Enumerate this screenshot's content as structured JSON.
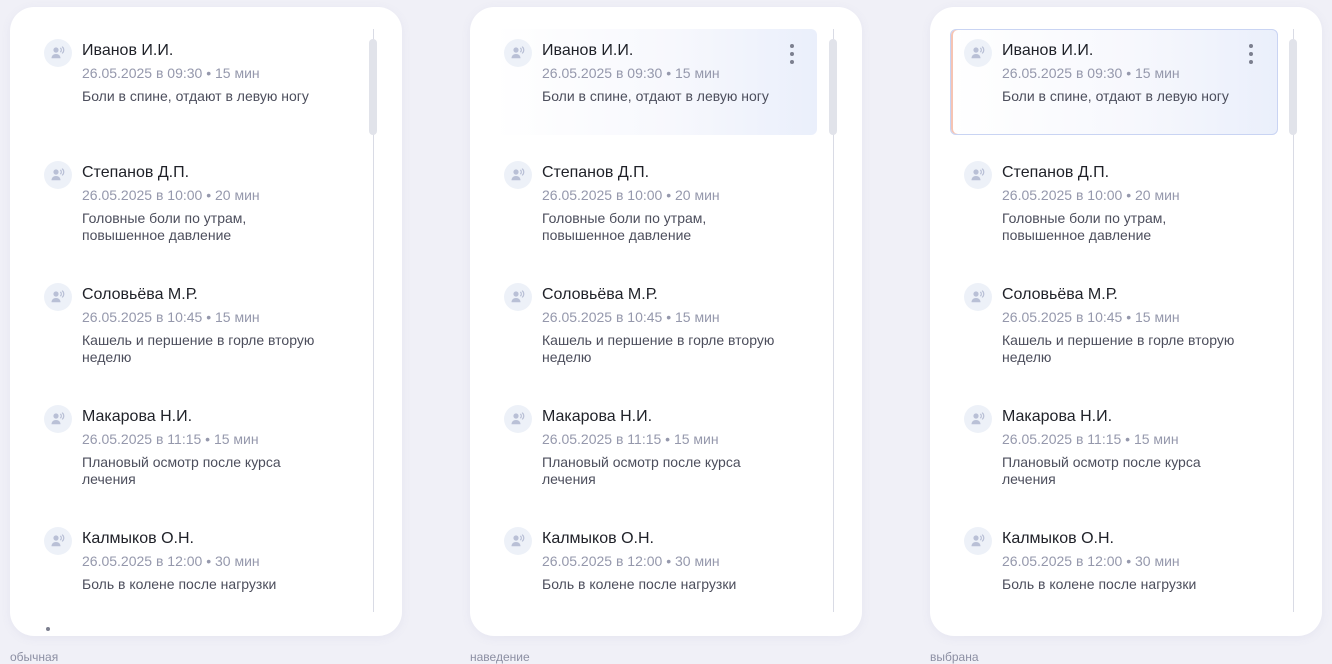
{
  "captions": [
    "обычная",
    "наведение",
    "выбрана"
  ],
  "appointments": [
    {
      "patient": "Иванов И.И.",
      "datetime": "26.05.2025 в 09:30 • 15 мин",
      "complaint": "Боли в спине, отдают в левую ногу"
    },
    {
      "patient": "Степанов Д.П.",
      "datetime": "26.05.2025 в 10:00 • 20 мин",
      "complaint": "Головные боли по утрам, повышенное давление"
    },
    {
      "patient": "Соловьёва М.Р.",
      "datetime": "26.05.2025 в 10:45 • 15 мин",
      "complaint": "Кашель и першение в горле вторую неделю"
    },
    {
      "patient": "Макарова Н.И.",
      "datetime": "26.05.2025 в 11:15 • 15 мин",
      "complaint": "Плановый осмотр после курса лечения"
    },
    {
      "patient": "Калмыков О.Н.",
      "datetime": "26.05.2025 в 12:00 • 30 мин",
      "complaint": "Боль в колене после нагрузки"
    }
  ],
  "icons": {
    "avatar": "user-voice-icon",
    "more": "more-vertical-icon"
  },
  "colors": {
    "page_bg": "#f0f0f7",
    "panel_bg": "#ffffff",
    "avatar_bg": "#edf1f8",
    "avatar_icon": "#b9c0d6",
    "meta_text": "#9598ac",
    "selected_border": "#c9d4f3",
    "selected_accent": "#f6c4b3"
  }
}
